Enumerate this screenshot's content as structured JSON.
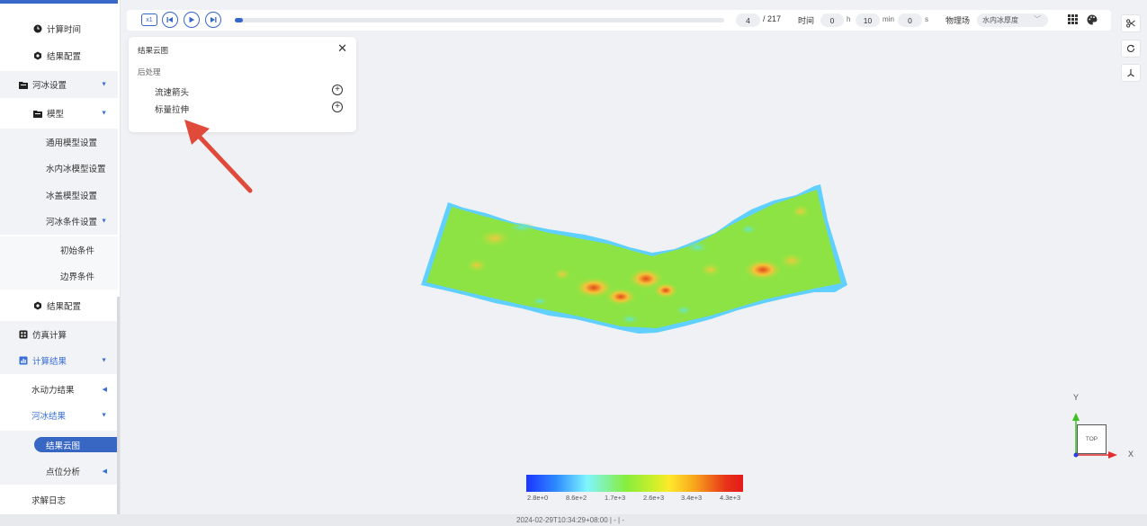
{
  "sidebar": {
    "items": [
      {
        "label": "计算时间",
        "icon": "clock-icon"
      },
      {
        "label": "结果配置",
        "icon": "gear-icon"
      },
      {
        "label": "河冰设置",
        "icon": "folder-icon"
      },
      {
        "label": "模型",
        "icon": "folder-icon"
      },
      {
        "label": "通用模型设置"
      },
      {
        "label": "水内冰模型设置"
      },
      {
        "label": "冰盖模型设置"
      },
      {
        "label": "河冰条件设置"
      },
      {
        "label": "初始条件"
      },
      {
        "label": "边界条件"
      },
      {
        "label": "结果配置",
        "icon": "gear-icon"
      },
      {
        "label": "仿真计算",
        "icon": "calculator-icon"
      },
      {
        "label": "计算结果",
        "icon": "chart-icon"
      },
      {
        "label": "水动力结果"
      },
      {
        "label": "河冰结果"
      },
      {
        "label": "结果云图"
      },
      {
        "label": "点位分析"
      },
      {
        "label": "求解日志"
      }
    ]
  },
  "toolbar": {
    "speed_label": "x1",
    "progress_fraction": 0.017,
    "frame_current": "4",
    "frame_total": "/ 217",
    "time_label": "时间",
    "hours_value": "0",
    "hours_unit": "h",
    "minutes_value": "10",
    "minutes_unit": "min",
    "seconds_value": "0",
    "seconds_unit": "s",
    "field_label": "物理场",
    "field_value": "水内冰厚度"
  },
  "panel": {
    "title": "结果云图",
    "section": "后处理",
    "rows": [
      {
        "label": "流速箭头"
      },
      {
        "label": "标量拉伸"
      }
    ]
  },
  "legend": {
    "labels": [
      "2.8e+0",
      "8.6e+2",
      "1.7e+3",
      "2.6e+3",
      "3.4e+3",
      "4.3e+3"
    ]
  },
  "axes": {
    "y": "Y",
    "x": "X",
    "view": "TOP"
  },
  "footer": {
    "text": "2024-02-29T10:34:29+08:00  |  -  |  -"
  },
  "colors": {
    "accent": "#3566c8",
    "arrow": "#e04a3a"
  }
}
